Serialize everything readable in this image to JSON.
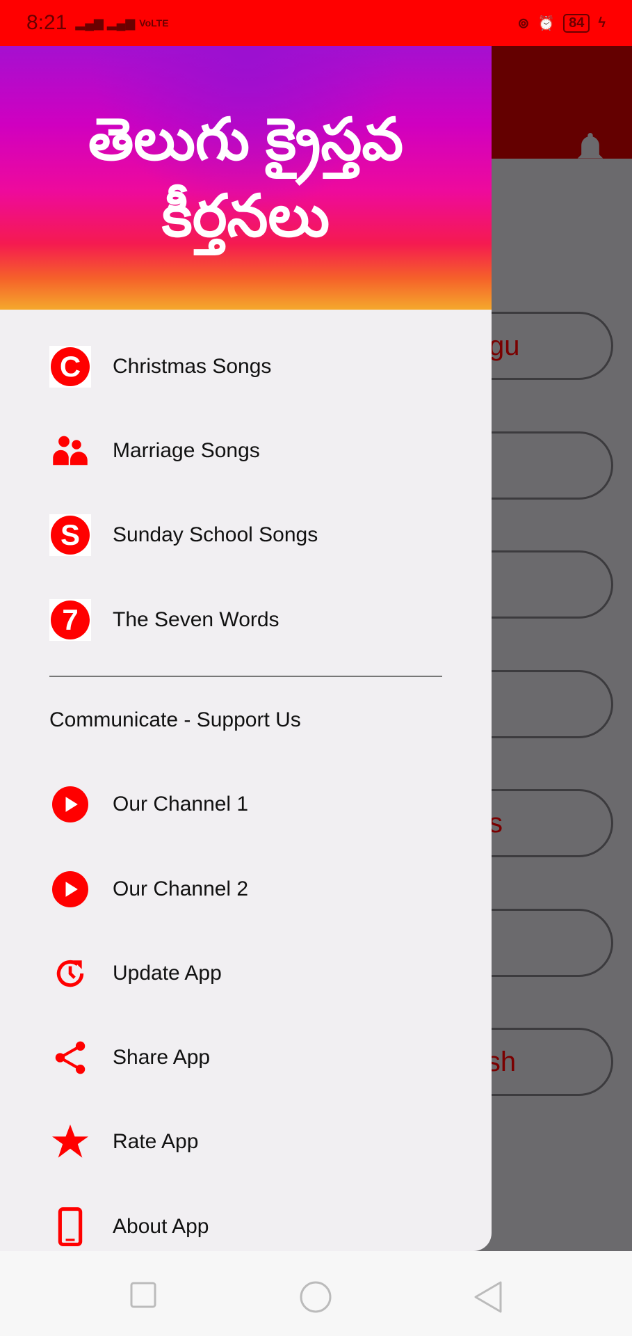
{
  "status_bar": {
    "time": "8:21",
    "network": "VoLTE",
    "battery": "84"
  },
  "background": {
    "pills": [
      "gu",
      "",
      "",
      "",
      "s",
      "",
      "ish"
    ]
  },
  "drawer": {
    "title_line1": "తెలుగు క్రైస్తవ",
    "title_line2": "కీర్తనలు",
    "items": [
      {
        "label": "Christmas Songs",
        "icon": "C"
      },
      {
        "label": "Marriage Songs",
        "icon": "people-icon"
      },
      {
        "label": "Sunday School Songs",
        "icon": "S"
      },
      {
        "label": "The Seven Words",
        "icon": "7"
      }
    ],
    "section_title": "Communicate - Support Us",
    "support_items": [
      {
        "label": "Our Channel 1",
        "icon": "youtube-play-icon"
      },
      {
        "label": "Our Channel 2",
        "icon": "youtube-play-icon"
      },
      {
        "label": "Update App",
        "icon": "update-icon"
      },
      {
        "label": "Share App",
        "icon": "share-icon"
      },
      {
        "label": "Rate App",
        "icon": "star-icon"
      },
      {
        "label": "About App",
        "icon": "phone-icon"
      }
    ]
  },
  "colors": {
    "accent": "#ff0000",
    "toolbar": "#640000",
    "drawer_bg": "#f1eff2"
  }
}
